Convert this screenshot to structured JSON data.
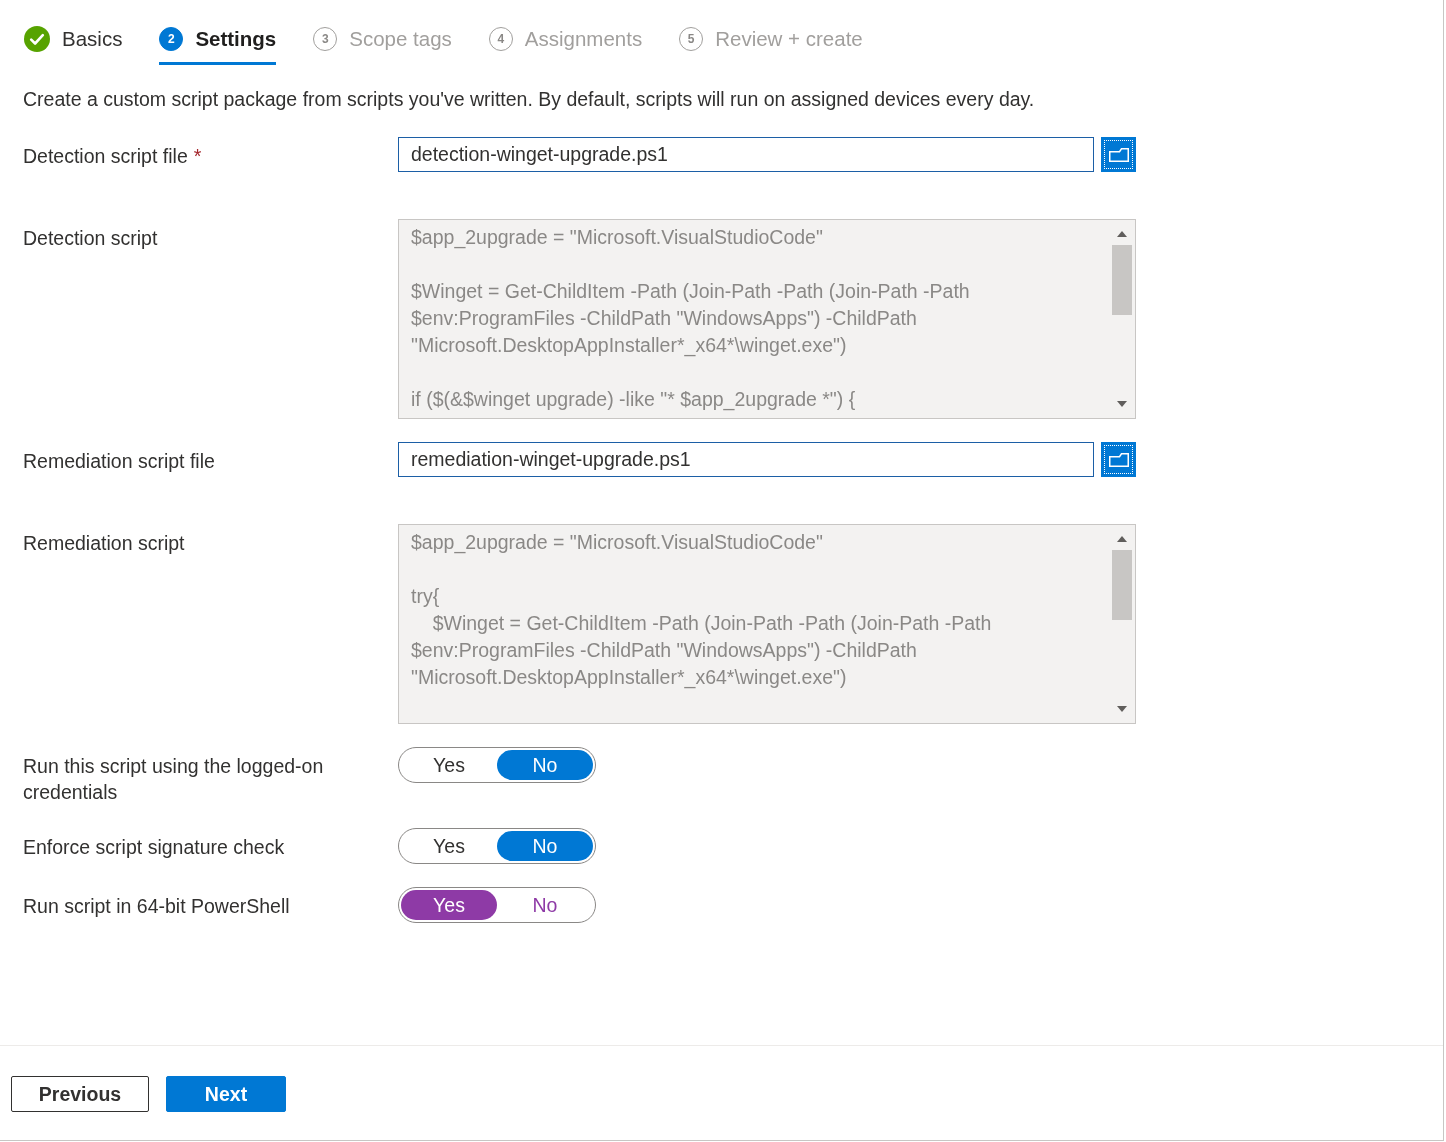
{
  "steps": [
    {
      "label": "Basics",
      "completed": true,
      "selected": false
    },
    {
      "number": "2",
      "label": "Settings",
      "completed": false,
      "selected": true
    },
    {
      "number": "3",
      "label": "Scope tags",
      "completed": false,
      "selected": false
    },
    {
      "number": "4",
      "label": "Assignments",
      "completed": false,
      "selected": false
    },
    {
      "number": "5",
      "label": "Review + create",
      "completed": false,
      "selected": false
    }
  ],
  "description": "Create a custom script package from scripts you've written. By default, scripts will run on assigned devices every day.",
  "fields": [
    {
      "kind": "file",
      "label": "Detection script file",
      "required_mark": "*",
      "value": "detection-winget-upgrade.ps1"
    },
    {
      "kind": "script",
      "label": "Detection script",
      "blocks": [
        [
          "$app_2upgrade = \"Microsoft.VisualStudioCode\""
        ],
        [
          "$Winget = Get-ChildItem -Path (Join-Path -Path (Join-Path -Path",
          "$env:ProgramFiles -ChildPath \"WindowsApps\") -ChildPath",
          "\"Microsoft.DesktopAppInstaller*_x64*\\winget.exe\")"
        ],
        [
          "if ($(&$winget upgrade) -like \"* $app_2upgrade *\") {"
        ]
      ]
    },
    {
      "kind": "file",
      "label": "Remediation script file",
      "value": "remediation-winget-upgrade.ps1"
    },
    {
      "kind": "script",
      "label": "Remediation script",
      "blocks": [
        [
          "$app_2upgrade = \"Microsoft.VisualStudioCode\""
        ],
        [
          "try{",
          "    $Winget = Get-ChildItem -Path (Join-Path -Path (Join-Path -Path",
          "$env:ProgramFiles -ChildPath \"WindowsApps\") -ChildPath",
          "\"Microsoft.DesktopAppInstaller*_x64*\\winget.exe\")"
        ]
      ]
    },
    {
      "kind": "toggle",
      "label": "Run this script using the logged-on credentials",
      "modified": false,
      "options": [
        {
          "label": "Yes",
          "selected": false
        },
        {
          "label": "No",
          "selected": true
        }
      ]
    },
    {
      "kind": "toggle",
      "label": "Enforce script signature check",
      "modified": false,
      "options": [
        {
          "label": "Yes",
          "selected": false
        },
        {
          "label": "No",
          "selected": true
        }
      ]
    },
    {
      "kind": "toggle",
      "label": "Run script in 64-bit PowerShell",
      "modified": true,
      "options": [
        {
          "label": "Yes",
          "selected": true
        },
        {
          "label": "No",
          "selected": false
        }
      ]
    }
  ],
  "buttons": [
    {
      "kind": "secondary",
      "label": "Previous"
    },
    {
      "kind": "primary",
      "label": "Next"
    }
  ]
}
